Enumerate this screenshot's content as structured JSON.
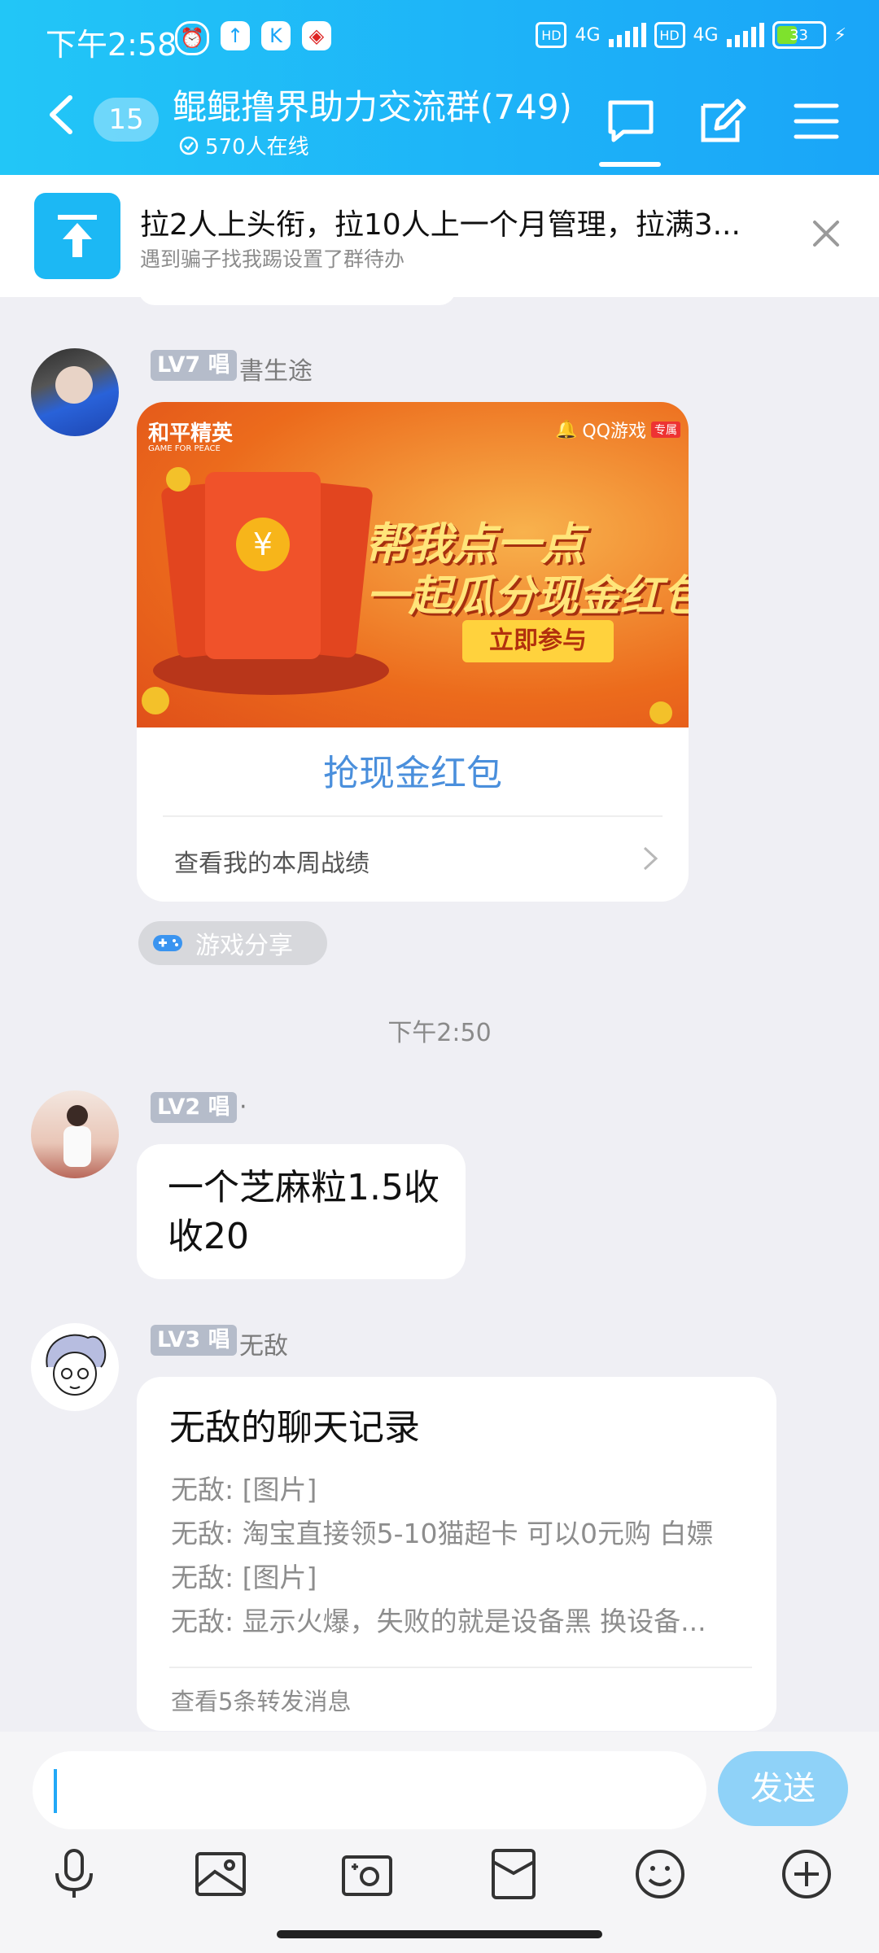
{
  "status_bar": {
    "time": "下午2:58",
    "network_left": "4G",
    "network_right": "4G",
    "hd_label": "HD",
    "battery": "33"
  },
  "header": {
    "unread_count": "15",
    "group_title": "鲲鲲撸界助力交流群(749)",
    "online_count": "570人在线"
  },
  "notice": {
    "title": "拉2人上头衔，拉10人上一个月管理，拉满3...",
    "subtitle": "遇到骗子找我踢设置了群待办"
  },
  "messages": [
    {
      "level": "LV7",
      "role": "唱",
      "sender": "書生途",
      "card": {
        "brand": "和平精英",
        "brand_sub": "GAME FOR PEACE",
        "platform": "QQ游戏",
        "platform_tag": "专属",
        "headline1": "帮我点一点",
        "headline2": "一起瓜分现金红包",
        "cta": "立即参与",
        "title": "抢现金红包",
        "footer": "查看我的本周战绩"
      },
      "tag": "游戏分享"
    },
    {
      "level": "LV2",
      "role": "唱",
      "sender": "·",
      "text": "一个芝麻粒1.5收收20"
    },
    {
      "level": "LV3",
      "role": "唱",
      "sender": "无敌",
      "forward": {
        "title": "无敌的聊天记录",
        "lines": [
          "无敌: [图片]",
          "无敌: 淘宝直接领5-10猫超卡 可以0元购 白嫖",
          "无敌: [图片]",
          "无敌: 显示火爆，失败的就是设备黑 换设备..."
        ],
        "footer": "查看5条转发消息"
      }
    }
  ],
  "time_separator": "下午2:50",
  "input": {
    "send_label": "发送",
    "value": ""
  },
  "colors": {
    "header_start": "#22c6f7",
    "header_end": "#1aa5f8",
    "link_blue": "#4a8fdc",
    "send_button": "#8fd2f8"
  }
}
